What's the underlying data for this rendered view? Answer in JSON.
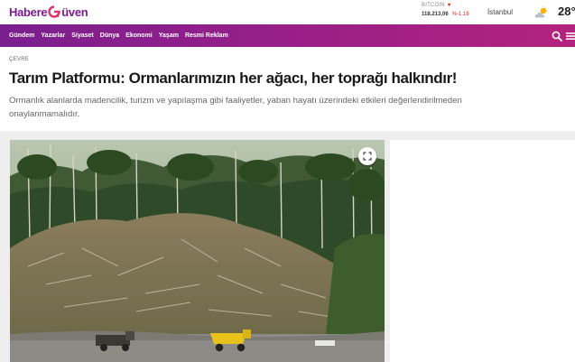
{
  "header": {
    "logo": {
      "part1": "Habere",
      "part2": "üven"
    },
    "ticker": {
      "name": "BITCOIN",
      "value": "118.213,06",
      "change": "%-1.16"
    },
    "weather": {
      "city": "İstanbul",
      "temp": "28°",
      "icon": "partly-cloudy-icon"
    }
  },
  "nav": {
    "items": [
      "Gündem",
      "Yazarlar",
      "Siyaset",
      "Dünya",
      "Ekonomi",
      "Yaşam",
      "Resmi Reklam"
    ],
    "search_icon": "search-icon",
    "menu_icon": "hamburger-icon"
  },
  "article": {
    "category": "ÇEVRE",
    "title": "Tarım Platformu: Ormanlarımızın her ağacı, her toprağı halkındır!",
    "summary": "Ormanlık alanlarda madencilik, turizm ve yapılaşma gibi faaliyetler, yaban hayatı üzerindeki etkileri değerlendirilmeden onaylanmamalıdır.",
    "expand_icon": "expand-icon"
  },
  "colors": {
    "brand_purple": "#7a1f8f",
    "nav_gradient_end": "#b3237d",
    "down_red": "#d9261c"
  }
}
